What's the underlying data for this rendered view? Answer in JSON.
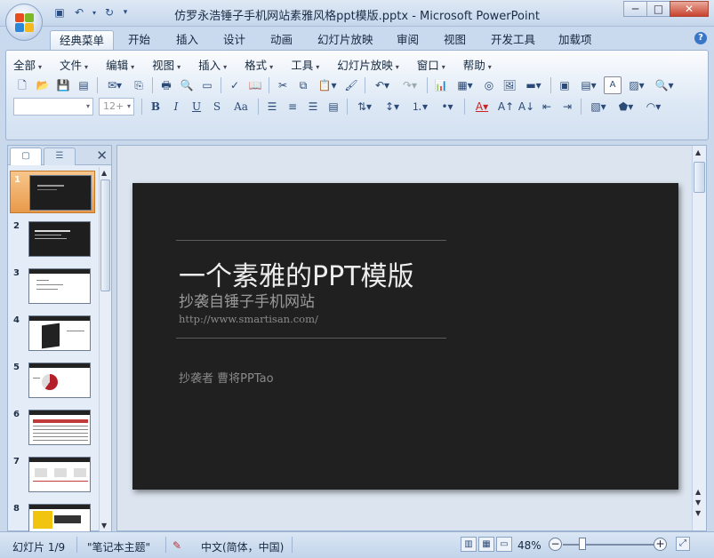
{
  "window": {
    "title": "仿罗永浩锤子手机网站素雅风格ppt模版.pptx - Microsoft PowerPoint",
    "minimize": "─",
    "maximize": "□",
    "close": "✕"
  },
  "quick_access": [
    "save-icon",
    "undo-icon",
    "redo-icon",
    "customize-icon"
  ],
  "ribbon_tabs": [
    "经典菜单",
    "开始",
    "插入",
    "设计",
    "动画",
    "幻灯片放映",
    "审阅",
    "视图",
    "开发工具",
    "加载项"
  ],
  "active_tab": "经典菜单",
  "classic_menu": [
    "全部",
    "文件",
    "编辑",
    "视图",
    "插入",
    "格式",
    "工具",
    "幻灯片放映",
    "窗口",
    "帮助"
  ],
  "toolbar": {
    "font_name": "",
    "font_size": "12+",
    "bold": "B",
    "italic": "I",
    "underline": "U",
    "strike": "S",
    "case": "Aa"
  },
  "left_panel": {
    "tab_slides": "▢",
    "tab_outline": "☰",
    "close": "✕",
    "slides": [
      {
        "num": "1",
        "style": "dark",
        "selected": true
      },
      {
        "num": "2",
        "style": "dark",
        "selected": false
      },
      {
        "num": "3",
        "style": "light",
        "selected": false
      },
      {
        "num": "4",
        "style": "light",
        "selected": false
      },
      {
        "num": "5",
        "style": "light",
        "selected": false
      },
      {
        "num": "6",
        "style": "light",
        "selected": false
      },
      {
        "num": "7",
        "style": "light",
        "selected": false
      },
      {
        "num": "8",
        "style": "light",
        "selected": false
      }
    ]
  },
  "slide": {
    "title": "一个素雅的PPT模版",
    "subtitle": "抄袭自锤子手机网站",
    "url": "http://www.smartisan.com/",
    "author": "抄袭者  曹将PPTao"
  },
  "status": {
    "slide_counter": "幻灯片 1/9",
    "theme": "\"笔记本主题\"",
    "language": "中文(简体，中国)",
    "zoom": "48%"
  },
  "colors": {
    "slide_bg": "#202020",
    "selected_thumb": "#f0aa5e",
    "ribbon_bg": "#dde8f5"
  }
}
